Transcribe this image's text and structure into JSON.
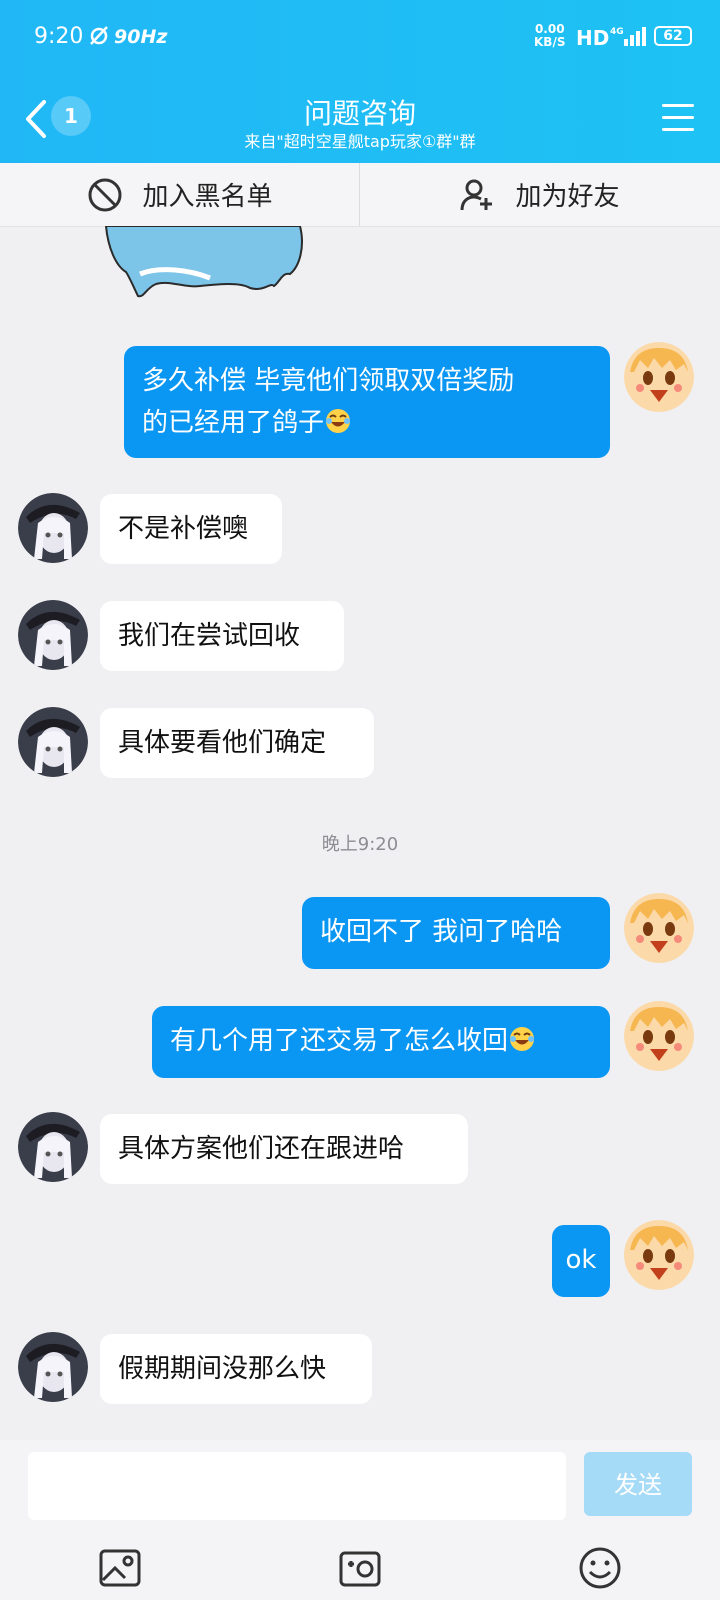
{
  "status_bar": {
    "time": "9:20",
    "refresh_rate": "90Hz",
    "net_speed_value": "0.00",
    "net_speed_unit": "KB/S",
    "hd_label": "HD",
    "network": "4G",
    "battery": "62"
  },
  "header": {
    "back_badge": "1",
    "title": "问题咨询",
    "subtitle": "来自\"超时空星舰tap玩家①群\"群"
  },
  "actions": {
    "blacklist_label": "加入黑名单",
    "add_friend_label": "加为好友"
  },
  "messages": [
    {
      "from": "me",
      "text": "多久补偿  毕竟他们领取双倍奖励",
      "text2": "的已经用了鸽子",
      "emoji": "laugh-cry-emoji"
    },
    {
      "from": "them",
      "text": "不是补偿噢"
    },
    {
      "from": "them",
      "text": "我们在尝试回收"
    },
    {
      "from": "them",
      "text": "具体要看他们确定"
    },
    {
      "from": "me",
      "text": "收回不了 我问了哈哈"
    },
    {
      "from": "me",
      "text": "有几个用了还交易了怎么收回",
      "emoji": "laugh-cry-emoji"
    },
    {
      "from": "them",
      "text": "具体方案他们还在跟进哈"
    },
    {
      "from": "me",
      "text": "ok"
    },
    {
      "from": "them",
      "text": "假期期间没那么快"
    }
  ],
  "time_separator": "晚上9:20",
  "composer": {
    "input_value": "",
    "send_label": "发送"
  },
  "toolbar": [
    "image-icon",
    "camera-icon",
    "emoji-icon"
  ],
  "colors": {
    "header": "#21b7f6",
    "my_bubble": "#0a96f3",
    "their_bubble": "#ffffff",
    "send_disabled": "#a6dbf8"
  }
}
